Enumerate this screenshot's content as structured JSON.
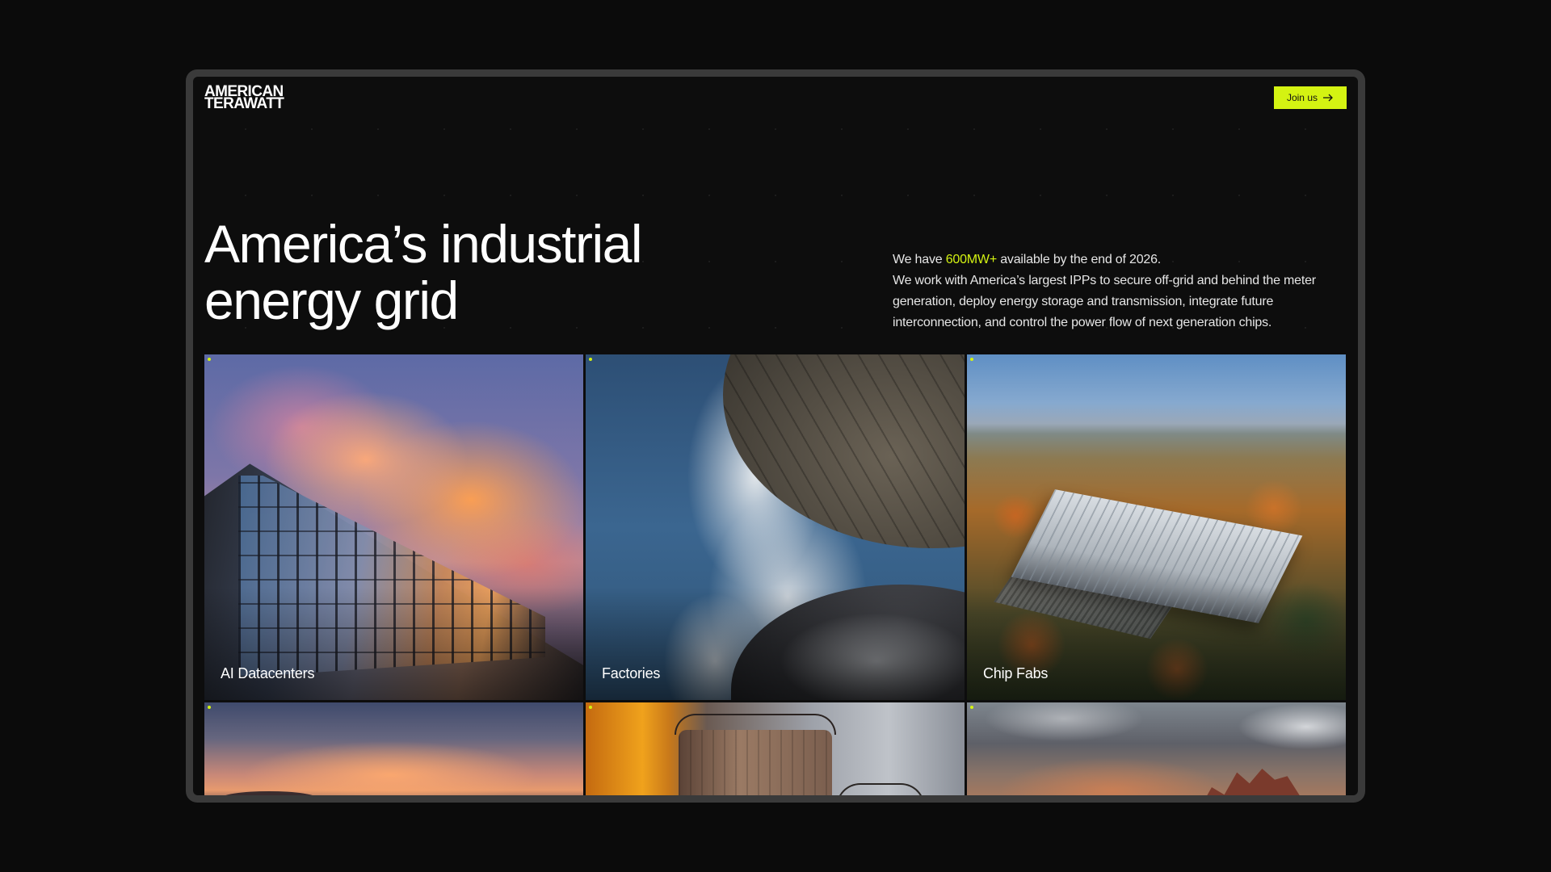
{
  "brand": {
    "logo_line1": "AMERICAN",
    "logo_line2": "TERAWATT"
  },
  "header": {
    "cta_label": "Join us",
    "cta_icon": "arrow-right-icon"
  },
  "hero": {
    "title": "America’s industrial energy grid",
    "desc_prefix": "We have ",
    "desc_highlight": "600MW+",
    "desc_suffix": " available by the end of 2026.",
    "desc_body": "We work with America’s largest IPPs to secure off-grid and behind the meter generation, deploy energy storage and transmission, integrate future interconnection, and control the power flow of next generation chips."
  },
  "cards": [
    {
      "label": "AI Datacenters"
    },
    {
      "label": "Factories"
    },
    {
      "label": "Chip Fabs"
    },
    {
      "label": ""
    },
    {
      "label": ""
    },
    {
      "label": ""
    }
  ],
  "colors": {
    "accent": "#d4f312",
    "background": "#0d0d0d",
    "frame": "#3a3a3a",
    "text": "#ffffff"
  }
}
